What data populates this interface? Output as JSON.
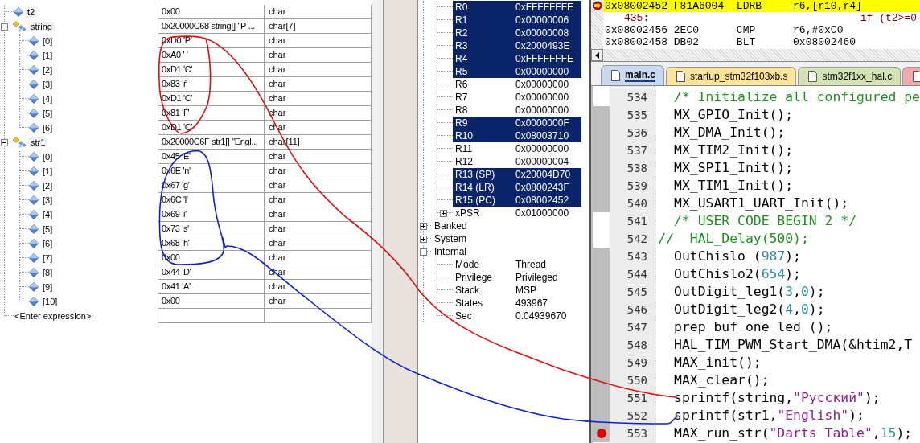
{
  "watch": {
    "rows": [
      {
        "name": "t2",
        "value": "0x00",
        "type": "char",
        "kind": "scalar"
      },
      {
        "name": "string",
        "value": "0x20000C68 string[] \"Р ...",
        "type": "char[7]",
        "kind": "array",
        "expanded": true,
        "children": [
          {
            "name": "[0]",
            "value": "0xD0 'Р'",
            "type": "char",
            "kind": "scalar"
          },
          {
            "name": "[1]",
            "value": "0xA0 ' '",
            "type": "char",
            "kind": "scalar"
          },
          {
            "name": "[2]",
            "value": "0xD1 'С'",
            "type": "char",
            "kind": "scalar"
          },
          {
            "name": "[3]",
            "value": "0x83 'ѓ'",
            "type": "char",
            "kind": "scalar"
          },
          {
            "name": "[4]",
            "value": "0xD1 'С'",
            "type": "char",
            "kind": "scalar"
          },
          {
            "name": "[5]",
            "value": "0x81 'Ѓ'",
            "type": "char",
            "kind": "scalar"
          },
          {
            "name": "[6]",
            "value": "0xD1 'С'",
            "type": "char",
            "kind": "scalar"
          }
        ]
      },
      {
        "name": "str1",
        "value": "0x20000C6F str1[] \"Engl...",
        "type": "char[11]",
        "kind": "array",
        "expanded": true,
        "children": [
          {
            "name": "[0]",
            "value": "0x45 'E'",
            "type": "char",
            "kind": "scalar"
          },
          {
            "name": "[1]",
            "value": "0x6E 'n'",
            "type": "char",
            "kind": "scalar"
          },
          {
            "name": "[2]",
            "value": "0x67 'g'",
            "type": "char",
            "kind": "scalar"
          },
          {
            "name": "[3]",
            "value": "0x6C 'l'",
            "type": "char",
            "kind": "scalar"
          },
          {
            "name": "[4]",
            "value": "0x69 'i'",
            "type": "char",
            "kind": "scalar"
          },
          {
            "name": "[5]",
            "value": "0x73 's'",
            "type": "char",
            "kind": "scalar"
          },
          {
            "name": "[6]",
            "value": "0x68 'h'",
            "type": "char",
            "kind": "scalar"
          },
          {
            "name": "[7]",
            "value": "0x00",
            "type": "char",
            "kind": "scalar"
          },
          {
            "name": "[8]",
            "value": "0x44 'D'",
            "type": "char",
            "kind": "scalar"
          },
          {
            "name": "[9]",
            "value": "0x41 'A'",
            "type": "char",
            "kind": "scalar"
          },
          {
            "name": "[10]",
            "value": "0x00",
            "type": "char",
            "kind": "scalar"
          }
        ]
      }
    ],
    "placeholder": "<Enter expression>"
  },
  "registers": {
    "items": [
      {
        "name": "R0",
        "value": "0xFFFFFFFE",
        "changed": true
      },
      {
        "name": "R1",
        "value": "0x00000006",
        "changed": true
      },
      {
        "name": "R2",
        "value": "0x00000008",
        "changed": true
      },
      {
        "name": "R3",
        "value": "0x2000493E",
        "changed": true
      },
      {
        "name": "R4",
        "value": "0xFFFFFFFE",
        "changed": true
      },
      {
        "name": "R5",
        "value": "0x00000000",
        "changed": true
      },
      {
        "name": "R6",
        "value": "0x00000000",
        "changed": false
      },
      {
        "name": "R7",
        "value": "0x00000000",
        "changed": false
      },
      {
        "name": "R8",
        "value": "0x00000000",
        "changed": false
      },
      {
        "name": "R9",
        "value": "0x0000000F",
        "changed": true
      },
      {
        "name": "R10",
        "value": "0x08003710",
        "changed": true
      },
      {
        "name": "R11",
        "value": "0x00000000",
        "changed": false
      },
      {
        "name": "R12",
        "value": "0x00000004",
        "changed": false
      },
      {
        "name": "R13 (SP)",
        "value": "0x20004D70",
        "changed": true
      },
      {
        "name": "R14 (LR)",
        "value": "0x0800243F",
        "changed": true
      },
      {
        "name": "R15 (PC)",
        "value": "0x08002452",
        "changed": true
      },
      {
        "name": "xPSR",
        "value": "0x01000000",
        "changed": false,
        "expanded": false
      }
    ],
    "groups": [
      {
        "name": "Banked",
        "expanded": false
      },
      {
        "name": "System",
        "expanded": false
      },
      {
        "name": "Internal",
        "expanded": true,
        "children": [
          {
            "name": "Mode",
            "value": "Thread"
          },
          {
            "name": "Privilege",
            "value": "Privileged"
          },
          {
            "name": "Stack",
            "value": "MSP"
          },
          {
            "name": "States",
            "value": "493967"
          },
          {
            "name": "Sec",
            "value": "0.04939670"
          }
        ]
      }
    ]
  },
  "disassembly": {
    "lines": [
      {
        "kind": "asm",
        "current": true,
        "address": "0x08002452",
        "opcode": "F81A6004",
        "mnemonic": "LDRB",
        "operands": "r6,[r10,r4]"
      },
      {
        "kind": "source",
        "line": "435:",
        "code": "if (t2>=0"
      },
      {
        "kind": "asm",
        "current": false,
        "address": "0x08002456",
        "opcode": "2EC0",
        "mnemonic": "CMP",
        "operands": "r6,#0xC0"
      },
      {
        "kind": "asm",
        "current": false,
        "address": "0x08002458",
        "opcode": "DB02",
        "mnemonic": "BLT",
        "operands": "0x08002460"
      }
    ]
  },
  "editor": {
    "tabs": [
      {
        "label": "main.c",
        "selected": true,
        "color": "#c9d9f2"
      },
      {
        "label": "startup_stm32f103xb.s",
        "selected": false,
        "color": "#fce49a"
      },
      {
        "label": "stm32f1xx_hal.c",
        "selected": false,
        "color": "#d3e3b6"
      },
      {
        "selected": false,
        "color": "#f4aaaa"
      }
    ],
    "lines": [
      {
        "number": "534",
        "executable": false,
        "breakpoint": false,
        "segments": [
          {
            "kind": "comment",
            "text": "  /* Initialize all configured pe"
          }
        ]
      },
      {
        "number": "535",
        "executable": true,
        "breakpoint": false,
        "segments": [
          {
            "kind": "plain",
            "text": "  MX_GPIO_Init();"
          }
        ]
      },
      {
        "number": "536",
        "executable": true,
        "breakpoint": false,
        "segments": [
          {
            "kind": "plain",
            "text": "  MX_DMA_Init();"
          }
        ]
      },
      {
        "number": "537",
        "executable": true,
        "breakpoint": false,
        "segments": [
          {
            "kind": "plain",
            "text": "  MX_TIM2_Init();"
          }
        ]
      },
      {
        "number": "538",
        "executable": true,
        "breakpoint": false,
        "segments": [
          {
            "kind": "plain",
            "text": "  MX_SPI1_Init();"
          }
        ]
      },
      {
        "number": "539",
        "executable": true,
        "breakpoint": false,
        "segments": [
          {
            "kind": "plain",
            "text": "  MX_TIM1_Init();"
          }
        ]
      },
      {
        "number": "540",
        "executable": true,
        "breakpoint": false,
        "segments": [
          {
            "kind": "plain",
            "text": "  MX_USART1_UART_Init();"
          }
        ]
      },
      {
        "number": "541",
        "executable": false,
        "breakpoint": false,
        "segments": [
          {
            "kind": "comment",
            "text": "  /* USER CODE BEGIN 2 */"
          }
        ]
      },
      {
        "number": "542",
        "executable": false,
        "breakpoint": false,
        "segments": [
          {
            "kind": "comment",
            "text": "//  HAL_Delay(500);"
          }
        ]
      },
      {
        "number": "543",
        "executable": true,
        "breakpoint": false,
        "segments": [
          {
            "kind": "plain",
            "text": "  OutChislo ("
          },
          {
            "kind": "number",
            "text": "987"
          },
          {
            "kind": "plain",
            "text": ");"
          }
        ]
      },
      {
        "number": "544",
        "executable": true,
        "breakpoint": false,
        "segments": [
          {
            "kind": "plain",
            "text": "  OutChislo2("
          },
          {
            "kind": "number",
            "text": "654"
          },
          {
            "kind": "plain",
            "text": ");"
          }
        ]
      },
      {
        "number": "545",
        "executable": true,
        "breakpoint": false,
        "segments": [
          {
            "kind": "plain",
            "text": "  OutDigit_leg1("
          },
          {
            "kind": "number",
            "text": "3"
          },
          {
            "kind": "plain",
            "text": ","
          },
          {
            "kind": "number",
            "text": "0"
          },
          {
            "kind": "plain",
            "text": ");"
          }
        ]
      },
      {
        "number": "546",
        "executable": true,
        "breakpoint": false,
        "segments": [
          {
            "kind": "plain",
            "text": "  OutDigit_leg2("
          },
          {
            "kind": "number",
            "text": "4"
          },
          {
            "kind": "plain",
            "text": ","
          },
          {
            "kind": "number",
            "text": "0"
          },
          {
            "kind": "plain",
            "text": ");"
          }
        ]
      },
      {
        "number": "547",
        "executable": true,
        "breakpoint": false,
        "segments": [
          {
            "kind": "plain",
            "text": "  prep_buf_one_led ();"
          }
        ]
      },
      {
        "number": "548",
        "executable": true,
        "breakpoint": false,
        "segments": [
          {
            "kind": "plain",
            "text": "  HAL_TIM_PWM_Start_DMA(&htim2,T"
          }
        ]
      },
      {
        "number": "549",
        "executable": true,
        "breakpoint": false,
        "segments": [
          {
            "kind": "plain",
            "text": "  MAX_init();"
          }
        ]
      },
      {
        "number": "550",
        "executable": true,
        "breakpoint": false,
        "segments": [
          {
            "kind": "plain",
            "text": "  MAX_clear();"
          }
        ]
      },
      {
        "number": "551",
        "executable": true,
        "breakpoint": false,
        "segments": [
          {
            "kind": "plain",
            "text": "  sprintf(string,"
          },
          {
            "kind": "string",
            "text": "\"Русский\""
          },
          {
            "kind": "plain",
            "text": ");"
          }
        ]
      },
      {
        "number": "552",
        "executable": true,
        "breakpoint": false,
        "segments": [
          {
            "kind": "plain",
            "text": "  sprintf(str1,"
          },
          {
            "kind": "string",
            "text": "\"English\""
          },
          {
            "kind": "plain",
            "text": ");"
          }
        ]
      },
      {
        "number": "553",
        "executable": true,
        "breakpoint": true,
        "segments": [
          {
            "kind": "plain",
            "text": "  MAX_run_str("
          },
          {
            "kind": "string",
            "text": "\"Darts Table\""
          },
          {
            "kind": "plain",
            "text": ","
          },
          {
            "kind": "number",
            "text": "15"
          },
          {
            "kind": "plain",
            "text": ");"
          }
        ]
      }
    ]
  }
}
